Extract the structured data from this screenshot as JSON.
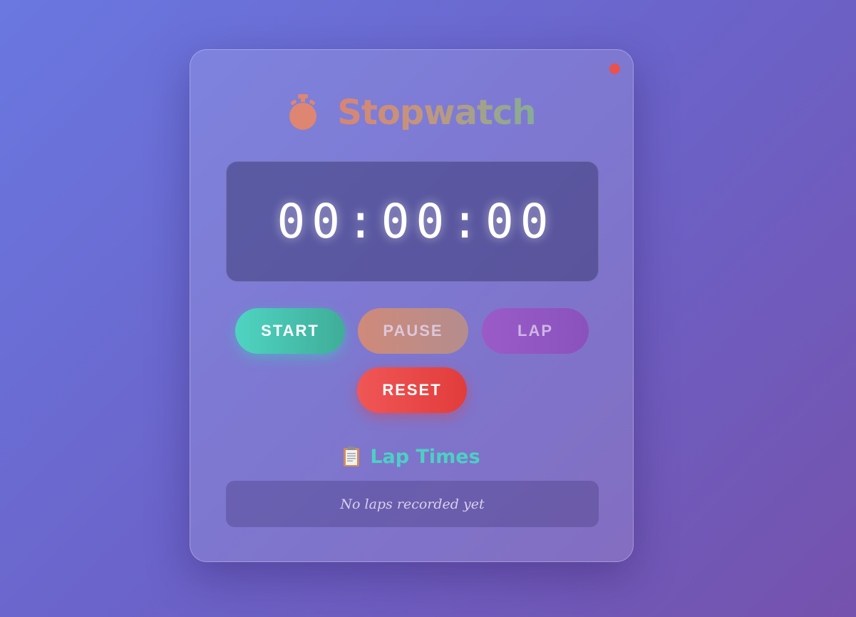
{
  "app": {
    "title": "Stopwatch",
    "title_icon": "stopwatch-icon"
  },
  "status": {
    "indicator_color": "#e8524f"
  },
  "display": {
    "time": "00:00:00"
  },
  "controls": {
    "start_label": "START",
    "pause_label": "PAUSE",
    "lap_label": "LAP",
    "reset_label": "RESET"
  },
  "laps": {
    "heading": "Lap Times",
    "heading_icon": "clipboard-icon",
    "empty_message": "No laps recorded yet",
    "items": []
  },
  "colors": {
    "start": "#4fd4c2",
    "pause": "#cf8a7a",
    "lap": "#9a5bc8",
    "reset": "#f05656",
    "accent": "#4dd0c4"
  }
}
